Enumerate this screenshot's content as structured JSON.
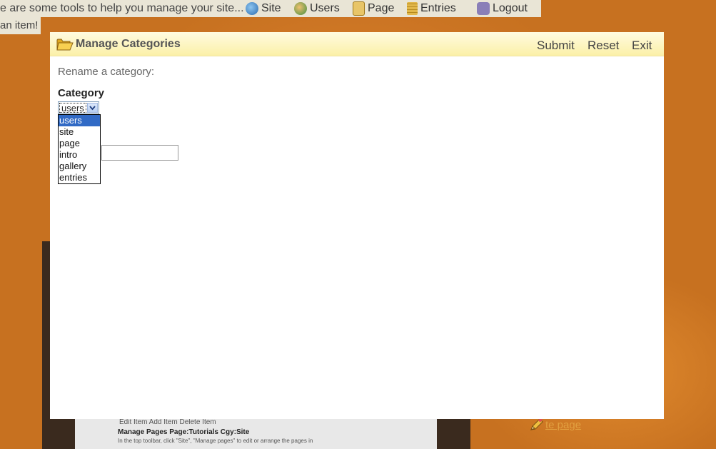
{
  "toolbar": {
    "message": "e are some tools to help you manage your site...",
    "items": [
      {
        "label": "Site",
        "icon": "globe-icon"
      },
      {
        "label": "Users",
        "icon": "users-icon"
      },
      {
        "label": "Page",
        "icon": "page-icon"
      },
      {
        "label": "Entries",
        "icon": "entries-icon"
      },
      {
        "label": "Logout",
        "icon": "logout-icon"
      }
    ]
  },
  "hint": "an item!",
  "background": {
    "snippet_row1": "Edit Item   Add Item   Delete Item",
    "snippet_row2": "Manage Pages  Page:Tutorials  Cgy:Site",
    "snippet_row3": "In the top toolbar, click \"Site\", \"Manage pages\" to edit or arrange the pages in",
    "link_text": "te page"
  },
  "modal": {
    "title": "Manage Categories",
    "title_icon": "folder-icon",
    "buttons": {
      "submit": "Submit",
      "reset": "Reset",
      "exit": "Exit"
    },
    "prompt": "Rename a category:",
    "category_label": "Category",
    "select": {
      "selected": "users",
      "options": [
        "users",
        "site",
        "page",
        "intro",
        "gallery",
        "entries"
      ]
    },
    "new_name_value": ""
  },
  "colors": {
    "background": "#c77120",
    "header_gradient_top": "#fffbe0",
    "header_gradient_bottom": "#fbf0a8",
    "selection": "#316ac5"
  }
}
